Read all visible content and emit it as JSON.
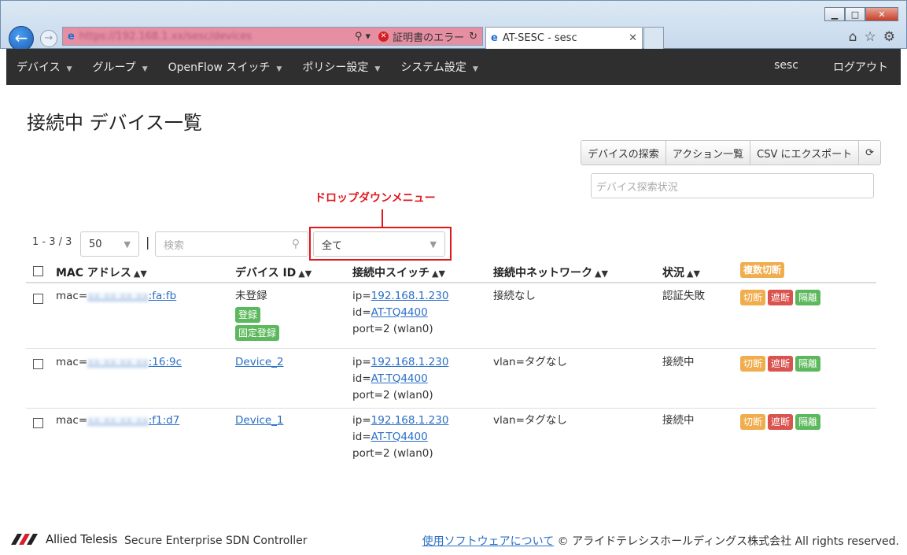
{
  "browser": {
    "url": "https://192.168.1.xx/sesc/devices",
    "cert_error": "証明書のエラー",
    "tab_title": "AT-SESC - sesc"
  },
  "nav": {
    "items": [
      {
        "label": "デバイス"
      },
      {
        "label": "グループ"
      },
      {
        "label": "OpenFlow スイッチ"
      },
      {
        "label": "ポリシー設定"
      },
      {
        "label": "システム設定"
      }
    ],
    "user": "sesc",
    "logout": "ログアウト"
  },
  "page": {
    "title": "接続中 デバイス一覧",
    "buttons": {
      "discover": "デバイスの探索",
      "actions": "アクション一覧",
      "export": "CSV にエクスポート"
    },
    "status_placeholder": "デバイス探索状況",
    "annotation": "ドロップダウンメニュー"
  },
  "controls": {
    "count": "1 - 3 / 3",
    "per_page": "50",
    "separator": "|",
    "search_placeholder": "検索",
    "filter": "全て"
  },
  "table": {
    "headers": {
      "mac": "MAC アドレス",
      "device_id": "デバイス ID",
      "switch": "接続中スイッチ",
      "network": "接続中ネットワーク",
      "status": "状況",
      "bulk_disconnect": "複数切断"
    },
    "rows": [
      {
        "mac_prefix": "mac=",
        "mac_hidden": "xx:xx:xx:xx",
        "mac_suffix": ":fa:fb",
        "device": "未登録",
        "register": "登録",
        "fixed_register": "固定登録",
        "ip_label": "ip=",
        "ip": "192.168.1.230",
        "id_label": "id=",
        "switch_id": "AT-TQ4400",
        "port": "port=2 (wlan0)",
        "network": "接続なし",
        "status": "認証失敗"
      },
      {
        "mac_prefix": "mac=",
        "mac_hidden": "xx:xx:xx:xx",
        "mac_suffix": ":16:9c",
        "device": "Device_2",
        "ip_label": "ip=",
        "ip": "192.168.1.230",
        "id_label": "id=",
        "switch_id": "AT-TQ4400",
        "port": "port=2 (wlan0)",
        "network": "vlan=タグなし",
        "status": "接続中"
      },
      {
        "mac_prefix": "mac=",
        "mac_hidden": "xx:xx:xx:xx",
        "mac_suffix": ":f1:d7",
        "device": "Device_1",
        "ip_label": "ip=",
        "ip": "192.168.1.230",
        "id_label": "id=",
        "switch_id": "AT-TQ4400",
        "port": "port=2 (wlan0)",
        "network": "vlan=タグなし",
        "status": "接続中"
      }
    ],
    "actions": {
      "disconnect": "切断",
      "block": "遮断",
      "isolate": "隔離"
    }
  },
  "footer": {
    "brand": "Allied Telesis",
    "product": "Secure Enterprise SDN Controller",
    "software_link": "使用ソフトウェアについて",
    "copyright": "© アライドテレシスホールディングス株式会社 All rights reserved."
  },
  "colors": {
    "navbar": "#2f2f2f",
    "annotation_red": "#e0171d",
    "badge_orange": "#f0ad4e",
    "badge_red": "#d9534f",
    "badge_green": "#5cb85c",
    "link_blue": "#2a6fc6"
  }
}
